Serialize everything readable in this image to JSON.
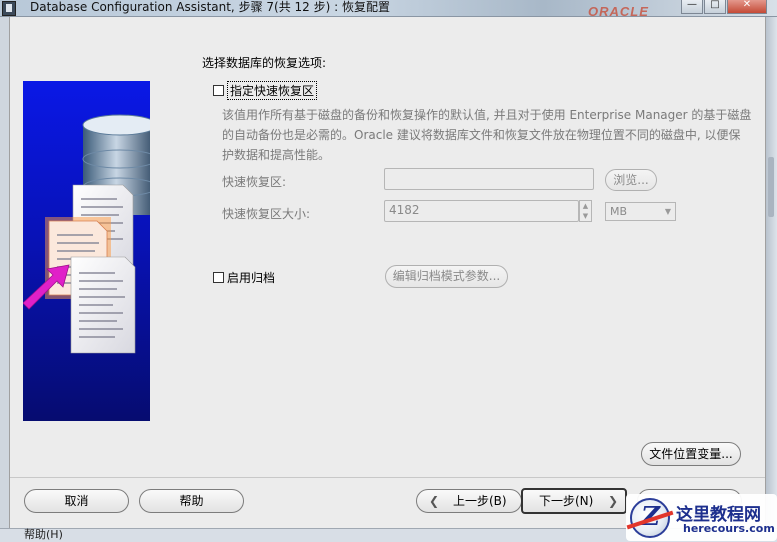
{
  "window": {
    "title": "Database Configuration Assistant, 步骤 7(共 12 步) : 恢复配置",
    "brand": "ORACLE",
    "minimize_glyph": "—",
    "maximize_glyph": "□",
    "close_glyph": "✕"
  },
  "main": {
    "section_label": "选择数据库的恢复选项:",
    "flash_recovery": {
      "checkbox_label": "指定快速恢复区",
      "checked": false,
      "description": "该值用作所有基于磁盘的备份和恢复操作的默认值, 并且对于使用 Enterprise Manager 的基于磁盘的自动备份也是必需的。Oracle 建议将数据库文件和恢复文件放在物理位置不同的磁盘中, 以便保护数据和提高性能。",
      "location_label": "快速恢复区:",
      "location_value": "",
      "browse_button": "浏览...",
      "size_label": "快速恢复区大小:",
      "size_value": "4182",
      "size_unit": "MB",
      "spin_up": "▲",
      "spin_down": "▼",
      "dropdown_glyph": "▼"
    },
    "archive": {
      "checkbox_label": "启用归档",
      "checked": false,
      "edit_button": "编辑归档模式参数..."
    },
    "file_location_button": "文件位置变量..."
  },
  "footer": {
    "cancel": "取消",
    "help": "帮助",
    "back": "上一步(B)",
    "next": "下一步(N)",
    "back_arrow": "❮",
    "next_arrow": "❯"
  },
  "bottom_strip": {
    "text": "帮助(H)"
  },
  "watermark": {
    "title": "这里教程网",
    "url": "herecours.com"
  },
  "colors": {
    "illustration_top": "#0a18e6",
    "illustration_bottom": "#060c70",
    "accent_arrow": "#e020c8",
    "disabled_text": "#7a7a7a"
  }
}
